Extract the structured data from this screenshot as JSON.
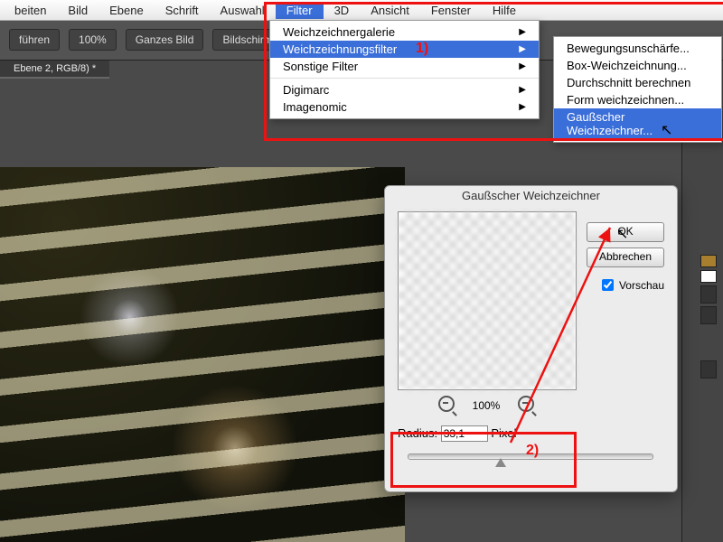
{
  "menubar": {
    "items": [
      "beiten",
      "Bild",
      "Ebene",
      "Schrift",
      "Auswahl",
      "Filter",
      "3D",
      "Ansicht",
      "Fenster",
      "Hilfe"
    ],
    "active_index": 5
  },
  "toolbar": {
    "btn_fuhren": "führen",
    "btn_zoom": "100%",
    "btn_ganzes": "Ganzes Bild",
    "btn_bildschirm": "Bildschirm aus"
  },
  "tab_label": "Ebene 2, RGB/8) *",
  "filter_menu": {
    "items": [
      {
        "label": "Weichzeichnergalerie",
        "arrow": true,
        "hi": false
      },
      {
        "label": "Weichzeichnungsfilter",
        "arrow": true,
        "hi": true
      },
      {
        "label": "Sonstige Filter",
        "arrow": true,
        "hi": false
      },
      {
        "sep": true
      },
      {
        "label": "Digimarc",
        "arrow": true,
        "hi": false
      },
      {
        "label": "Imagenomic",
        "arrow": true,
        "hi": false
      }
    ]
  },
  "blur_submenu": {
    "items": [
      {
        "label": "Bewegungsunschärfe...",
        "hi": false
      },
      {
        "label": "Box-Weichzeichnung...",
        "hi": false
      },
      {
        "label": "Durchschnitt berechnen",
        "hi": false
      },
      {
        "label": "Form weichzeichnen...",
        "hi": false
      },
      {
        "label": "Gaußscher Weichzeichner...",
        "hi": true
      }
    ]
  },
  "dialog": {
    "title": "Gaußscher Weichzeichner",
    "ok": "OK",
    "cancel": "Abbrechen",
    "preview_label": "Vorschau",
    "preview_checked": true,
    "zoom_label": "100%",
    "radius_label": "Radius:",
    "radius_value": "33,1",
    "radius_unit": "Pixel"
  },
  "annotations": {
    "step1": "1)",
    "step2": "2)"
  }
}
